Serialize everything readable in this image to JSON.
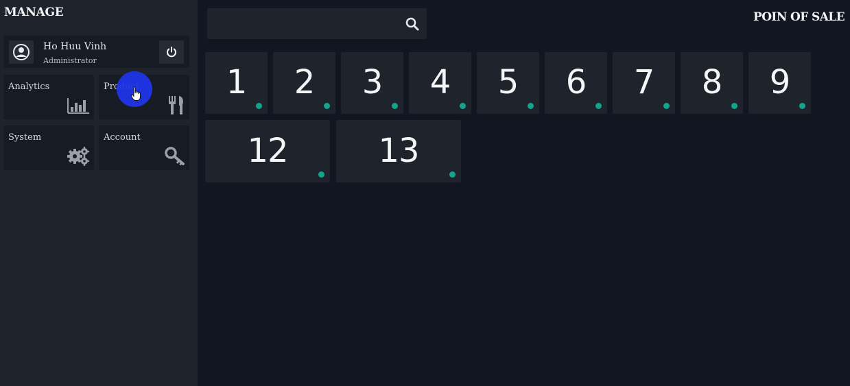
{
  "sidebar": {
    "title": "MANAGE",
    "user": {
      "name": "Ho Huu Vinh",
      "role": "Administrator",
      "avatar_icon": "user-circle-icon",
      "power_icon": "power-icon"
    },
    "tiles": [
      {
        "label": "Analytics",
        "icon": "bar-chart-icon"
      },
      {
        "label": "Product",
        "icon": "fork-knife-icon"
      },
      {
        "label": "System",
        "icon": "gears-icon"
      },
      {
        "label": "Account",
        "icon": "key-icon"
      }
    ]
  },
  "header": {
    "app_title": "POIN OF SALE",
    "search": {
      "value": "",
      "placeholder": "",
      "icon": "search-icon"
    }
  },
  "tables": [
    {
      "number": "1",
      "status": "available"
    },
    {
      "number": "2",
      "status": "available"
    },
    {
      "number": "3",
      "status": "available"
    },
    {
      "number": "4",
      "status": "available"
    },
    {
      "number": "5",
      "status": "available"
    },
    {
      "number": "6",
      "status": "available"
    },
    {
      "number": "7",
      "status": "available"
    },
    {
      "number": "8",
      "status": "available"
    },
    {
      "number": "9",
      "status": "available"
    },
    {
      "number": "12",
      "status": "available"
    },
    {
      "number": "13",
      "status": "available"
    }
  ],
  "colors": {
    "status_available": "#14a38b",
    "click_highlight": "#1f35e6"
  }
}
